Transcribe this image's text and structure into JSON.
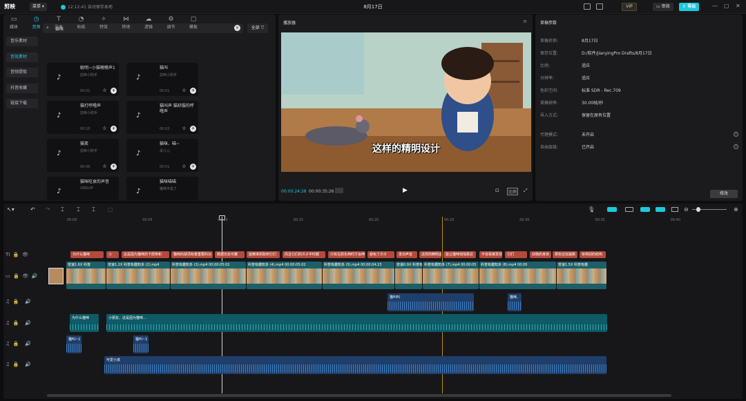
{
  "titlebar": {
    "logo": "剪映",
    "menu": "菜单",
    "autosave": "12:12:41 自动保存本地",
    "project_title": "8月17日",
    "vip": "VIP",
    "review": "审阅",
    "export": "导出"
  },
  "media": {
    "tabs": [
      {
        "label": "媒体",
        "icon": "▭"
      },
      {
        "label": "音频",
        "icon": "◷"
      },
      {
        "label": "文本",
        "icon": "T"
      },
      {
        "label": "贴纸",
        "icon": "◔"
      },
      {
        "label": "特效",
        "icon": "✧"
      },
      {
        "label": "转场",
        "icon": "⋈"
      },
      {
        "label": "滤镜",
        "icon": "☁"
      },
      {
        "label": "调节",
        "icon": "⚙"
      },
      {
        "label": "模板",
        "icon": "▢"
      }
    ],
    "categories": [
      "音乐素材",
      "音效素材",
      "音频提取",
      "抖音收藏",
      "链接下载"
    ],
    "search_value": "猫咪",
    "filter": "全部",
    "cards": [
      {
        "title": "聪明~小猫嗷嗷声1",
        "author": "剪映小助手",
        "dur": "00:01"
      },
      {
        "title": "猫叫",
        "author": "剪映小助手",
        "dur": "00:01"
      },
      {
        "title": "猫打呼噜声",
        "author": "剪映小助手",
        "dur": "00:10"
      },
      {
        "title": "猫叫声 猫舒服的呼噜声",
        "author": "",
        "dur": "00:02"
      },
      {
        "title": "猫笑",
        "author": "剪映小助手",
        "dur": "00:06"
      },
      {
        "title": "猫咪、喵~",
        "author": "朵儿儿",
        "dur": "00:01"
      },
      {
        "title": "猫咪吃食的声音",
        "author": "XINGUP",
        "dur": ""
      },
      {
        "title": "猫咪喵喵",
        "author": "猫咪不是了",
        "dur": ""
      }
    ]
  },
  "player": {
    "title": "播放器",
    "subtitle": "这样的精明设计",
    "timecode_current": "00:00:24:28",
    "timecode_total": "00:00:35:26"
  },
  "props": {
    "title": "草稿参数",
    "rows": [
      {
        "label": "草稿名称:",
        "value": "8月17日"
      },
      {
        "label": "保存位置:",
        "value": "D:/软件/JianyingPro Drafts/8月17日"
      },
      {
        "label": "比例:",
        "value": "适应"
      },
      {
        "label": "分辨率:",
        "value": "适应"
      },
      {
        "label": "色彩空间:",
        "value": "标准 SDR - Rec.709"
      },
      {
        "label": "草稿帧率:",
        "value": "30.00帧/秒"
      },
      {
        "label": "导入方式:",
        "value": "保留在原有位置"
      },
      {
        "label": "代理模式:",
        "value": "未开启"
      },
      {
        "label": "自由层级:",
        "value": "已开启"
      }
    ],
    "modify": "修改"
  },
  "timeline": {
    "ruler": [
      "00:00",
      "00:05",
      "00:10",
      "00:15",
      "00:20",
      "00:25",
      "00:30",
      "00:35",
      "00:40"
    ],
    "caption_clips": [
      "为什么猫咪",
      "小",
      "这是因为猫咪的下颌骨和",
      "猫咪的胡须有着重要的功",
      "数据无处可藏",
      "能精准抓取到它们",
      "而且它们的爪子平时都",
      "只有在抓东西时才会伸",
      "避免了爪子",
      "发出声音",
      "这样的精明设计",
      "能让猫咪悄悄靠近",
      "不容易被发现",
      "它们",
      "动物的身体",
      "那些还加速跳",
      "有特别的结构"
    ],
    "video_clips": [
      {
        "label": "变速1.6X  科普"
      },
      {
        "label": "变速1.2X  科普有趣知多 (2).mp4"
      },
      {
        "label": "科普有趣知多 (3).mp4  00:00:05:02"
      },
      {
        "label": "科普有趣知多 (4).mp4  00:00:05:02"
      },
      {
        "label": "科普有趣知多 (5).mp4  00:00:04:23"
      },
      {
        "label": "变速0.9X  科普有趣"
      },
      {
        "label": "科普有趣知多 (7).mp4  00:00:05"
      },
      {
        "label": "科普有趣知多 (8).mp4  00:00"
      },
      {
        "label": "变速1.5X  科普有趣"
      }
    ],
    "sfx_clips": [
      "猫叫叫",
      "猫咪、"
    ],
    "voice_clips": [
      "为什么猫咪",
      "小朋友，这是因为猫咪..."
    ],
    "meow_clips": [
      "猫叫~1",
      "猫叫~1"
    ],
    "music_clip": "可爱小孩"
  }
}
